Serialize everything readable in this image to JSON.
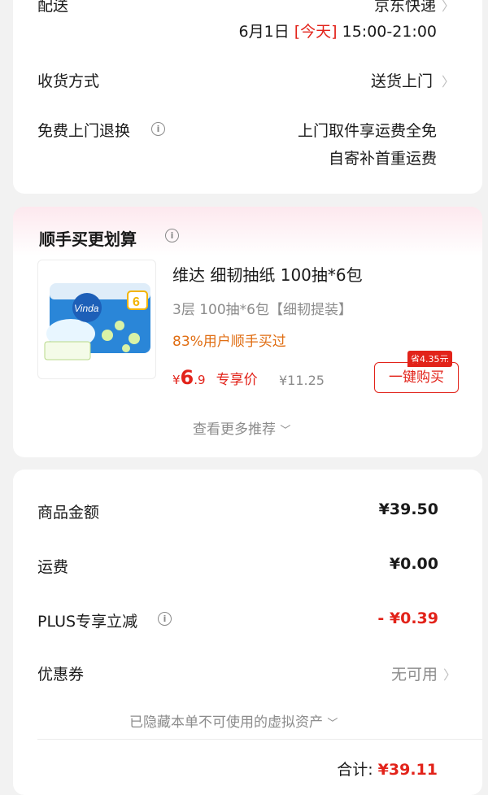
{
  "delivery": {
    "label": "配送",
    "carrier": "京东快递",
    "date": "6月1日",
    "today_tag": "[今天]",
    "time_window": "15:00-21:00",
    "receive_method_label": "收货方式",
    "receive_method_value": "送货上门",
    "free_return_label": "免费上门退换",
    "free_return_line1": "上门取件享运费全免",
    "free_return_line2": "自寄补首重运费"
  },
  "addon": {
    "section_title": "顺手买更划算",
    "product_name": "维达 细韧抽纸 100抽*6包",
    "product_spec": "3层 100抽*6包【细韧提装】",
    "product_social": "83%用户顺手买过",
    "price_symbol": "¥",
    "price_int": "6",
    "price_dec": ".9",
    "price_tag": "专享价",
    "original_price": "¥11.25",
    "save_badge": "省4.35元",
    "buy_button": "一键购买",
    "more_link": "查看更多推荐",
    "image_brand": "Vinda",
    "image_count": "6"
  },
  "summary": {
    "goods_label": "商品金额",
    "goods_value": "¥39.50",
    "shipping_label": "运费",
    "shipping_value": "¥0.00",
    "plus_label": "PLUS专享立减",
    "plus_value": "- ¥0.39",
    "coupon_label": "优惠券",
    "coupon_value": "无可用",
    "hidden_assets": "已隐藏本单不可使用的虚拟资产",
    "total_label": "合计:",
    "total_value": "¥39.11"
  },
  "colors": {
    "accent_red": "#e2231a",
    "orange": "#e06d12",
    "pink_header": "#fde8ee"
  },
  "icons": [
    "info-icon",
    "chevron-right-icon",
    "chevron-down-icon",
    "product-image"
  ]
}
